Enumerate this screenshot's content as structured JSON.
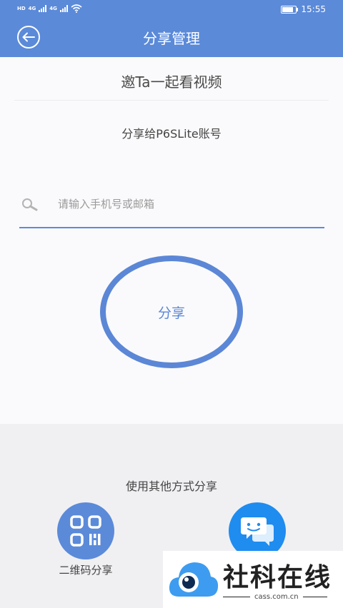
{
  "status_bar": {
    "left_tags": [
      "HD",
      "4G",
      "4G"
    ],
    "time": "15:55"
  },
  "header": {
    "title": "分享管理"
  },
  "main": {
    "invite_title": "邀Ta一起看视频",
    "share_to": "分享给P6SLite账号",
    "search": {
      "value": "",
      "placeholder": "请输入手机号或邮箱"
    },
    "share_button_label": "分享"
  },
  "other": {
    "title": "使用其他方式分享",
    "options": [
      {
        "icon": "qr-code-icon",
        "label": "二维码分享"
      },
      {
        "icon": "chat-bubble-icon",
        "label": ""
      }
    ]
  },
  "watermark": {
    "name": "社科在线",
    "url": "cass.com.cn"
  },
  "colors": {
    "accent": "#5b8ad9",
    "share_ring": "#5b87d6",
    "message_blue": "#1f8cf0",
    "panel_bg": "#f0f0f3",
    "content_bg": "#fafafc"
  }
}
